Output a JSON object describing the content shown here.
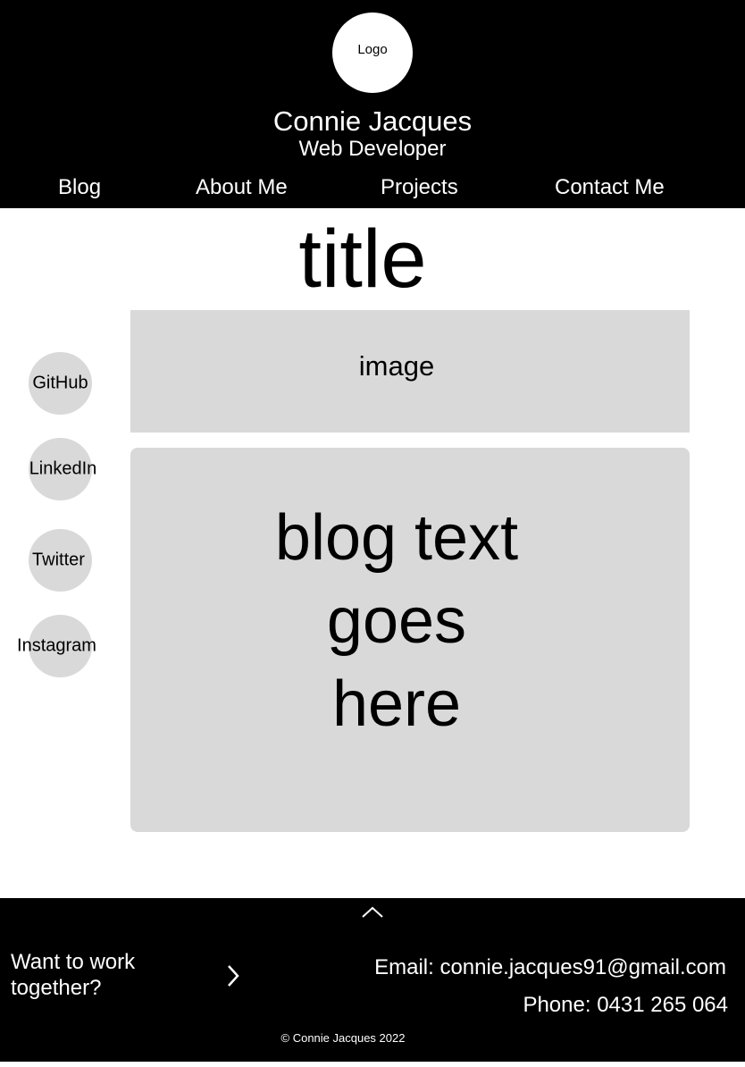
{
  "header": {
    "logo": "Logo",
    "name": "Connie Jacques",
    "role": "Web Developer"
  },
  "nav": [
    "Blog",
    "About Me",
    "Projects",
    "Contact Me"
  ],
  "main": {
    "title": "title",
    "image": "image",
    "blog_text": "blog text goes here"
  },
  "social": [
    "GitHub",
    "LinkedIn",
    "Twitter",
    "Instagram"
  ],
  "footer": {
    "cta": "Want to work together?",
    "email": "Email: connie.jacques91@gmail.com",
    "phone": "Phone: 0431 265 064",
    "copyright": "© Connie Jacques 2022"
  }
}
